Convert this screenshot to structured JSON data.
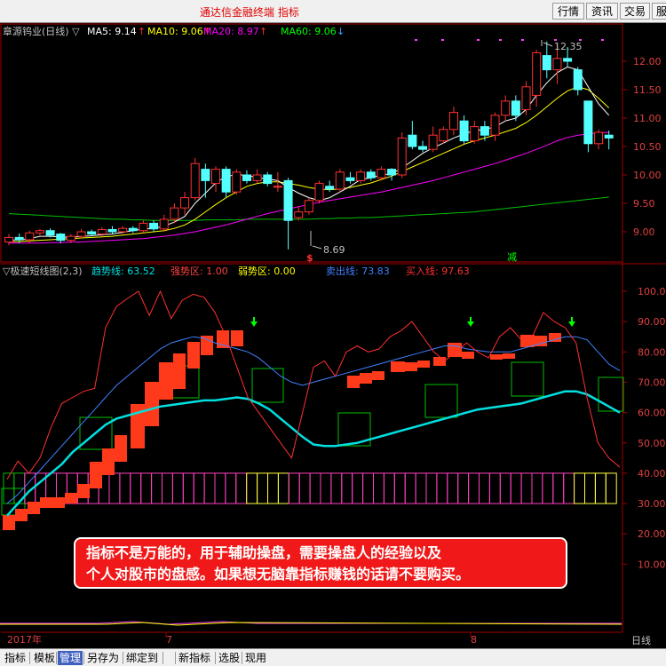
{
  "app": {
    "title": "通达信金融终端  指标",
    "buttons": [
      "行情",
      "资讯",
      "交易",
      "服"
    ]
  },
  "main_panel": {
    "stock_title": "章源钨业(日线) ▽",
    "ma_labels": [
      {
        "text": "MA5: 9.14",
        "arrow": "↑",
        "color": "#ffffff"
      },
      {
        "text": "MA10: 9.06",
        "arrow": "↑",
        "color": "#ffff00"
      },
      {
        "text": "MA20: 8.97",
        "arrow": "↑",
        "color": "#ff00ff"
      },
      {
        "text": "MA60: 9.06",
        "arrow": "↓",
        "color": "#00ff00"
      }
    ],
    "high_label": "12.35",
    "low_label": "8.69",
    "buy_sign": "$",
    "sell_sign": "减"
  },
  "indicator_panel": {
    "title": "▽极速短线图(2,3)",
    "labels": [
      {
        "text": "趋势线: 63.52",
        "color": "#00e0e0"
      },
      {
        "text": "强势区: 1.00",
        "color": "#ff4040"
      },
      {
        "text": "弱势区: 0.00",
        "color": "#ffff00"
      },
      {
        "text": "卖出线: 73.83",
        "color": "#4080ff"
      },
      {
        "text": "买入线: 97.63",
        "color": "#ff3030"
      }
    ]
  },
  "disclaimer": {
    "line1": "指标不是万能的，用于辅助操盘，需要操盘人的经验以及",
    "line2": "个人对股市的盘感。如果想无脑靠指标赚钱的话请不要购买。"
  },
  "date_axis": {
    "labels": [
      "2017年",
      "7",
      "8"
    ],
    "period": "日线"
  },
  "bottom_tabs": [
    "指标",
    "模板",
    "管理",
    "另存为",
    "绑定到",
    "新指标",
    "选股",
    "现用"
  ],
  "bottom_tab_active": "管理",
  "chart_data": [
    {
      "type": "candlestick",
      "title": "章源钨业(日线)",
      "y_ticks": [
        "12.00",
        "11.50",
        "11.00",
        "10.50",
        "10.00",
        "9.50",
        "9.00"
      ],
      "ylim": [
        8.6,
        12.6
      ],
      "candles": [
        {
          "o": 8.82,
          "c": 8.9,
          "h": 8.96,
          "l": 8.76
        },
        {
          "o": 8.9,
          "c": 8.86,
          "h": 8.97,
          "l": 8.8
        },
        {
          "o": 8.86,
          "c": 8.98,
          "h": 9.02,
          "l": 8.8
        },
        {
          "o": 8.98,
          "c": 9.02,
          "h": 9.05,
          "l": 8.92
        },
        {
          "o": 9.02,
          "c": 8.94,
          "h": 9.06,
          "l": 8.9
        },
        {
          "o": 8.96,
          "c": 8.85,
          "h": 8.98,
          "l": 8.8
        },
        {
          "o": 8.85,
          "c": 8.92,
          "h": 8.96,
          "l": 8.8
        },
        {
          "o": 8.92,
          "c": 9.0,
          "h": 9.05,
          "l": 8.88
        },
        {
          "o": 9.0,
          "c": 8.96,
          "h": 9.04,
          "l": 8.92
        },
        {
          "o": 8.96,
          "c": 9.04,
          "h": 9.08,
          "l": 8.92
        },
        {
          "o": 9.04,
          "c": 9.0,
          "h": 9.1,
          "l": 8.96
        },
        {
          "o": 9.0,
          "c": 9.06,
          "h": 9.1,
          "l": 8.96
        },
        {
          "o": 9.06,
          "c": 9.02,
          "h": 9.1,
          "l": 8.98
        },
        {
          "o": 9.02,
          "c": 9.15,
          "h": 9.2,
          "l": 8.98
        },
        {
          "o": 9.15,
          "c": 9.05,
          "h": 9.2,
          "l": 9.0
        },
        {
          "o": 9.05,
          "c": 9.22,
          "h": 9.3,
          "l": 9.0
        },
        {
          "o": 9.22,
          "c": 9.42,
          "h": 9.5,
          "l": 9.15
        },
        {
          "o": 9.42,
          "c": 9.6,
          "h": 9.7,
          "l": 9.3
        },
        {
          "o": 9.6,
          "c": 10.2,
          "h": 10.3,
          "l": 9.55
        },
        {
          "o": 10.1,
          "c": 9.9,
          "h": 10.2,
          "l": 9.6
        },
        {
          "o": 9.85,
          "c": 10.1,
          "h": 10.15,
          "l": 9.7
        },
        {
          "o": 10.1,
          "c": 9.7,
          "h": 10.15,
          "l": 9.6
        },
        {
          "o": 9.7,
          "c": 10.05,
          "h": 10.1,
          "l": 9.65
        },
        {
          "o": 10.0,
          "c": 9.9,
          "h": 10.08,
          "l": 9.85
        },
        {
          "o": 9.9,
          "c": 10.0,
          "h": 10.1,
          "l": 9.85
        },
        {
          "o": 10.0,
          "c": 9.85,
          "h": 10.05,
          "l": 9.8
        },
        {
          "o": 9.8,
          "c": 9.8,
          "h": 10.05,
          "l": 9.7
        },
        {
          "o": 9.9,
          "c": 9.2,
          "h": 9.95,
          "l": 8.69
        },
        {
          "o": 9.25,
          "c": 9.35,
          "h": 9.45,
          "l": 9.2
        },
        {
          "o": 9.35,
          "c": 9.55,
          "h": 9.6,
          "l": 9.3
        },
        {
          "o": 9.55,
          "c": 9.85,
          "h": 9.9,
          "l": 9.5
        },
        {
          "o": 9.8,
          "c": 9.75,
          "h": 9.9,
          "l": 9.7
        },
        {
          "o": 9.75,
          "c": 10.05,
          "h": 10.1,
          "l": 9.7
        },
        {
          "o": 9.95,
          "c": 9.9,
          "h": 10.05,
          "l": 9.85
        },
        {
          "o": 9.9,
          "c": 10.05,
          "h": 10.1,
          "l": 9.85
        },
        {
          "o": 10.05,
          "c": 9.95,
          "h": 10.1,
          "l": 9.9
        },
        {
          "o": 9.95,
          "c": 10.1,
          "h": 10.15,
          "l": 9.9
        },
        {
          "o": 10.1,
          "c": 10.0,
          "h": 10.12,
          "l": 9.9
        },
        {
          "o": 10.0,
          "c": 10.65,
          "h": 10.75,
          "l": 9.95
        },
        {
          "o": 10.7,
          "c": 10.5,
          "h": 10.95,
          "l": 10.45
        },
        {
          "o": 10.5,
          "c": 10.45,
          "h": 10.6,
          "l": 10.4
        },
        {
          "o": 10.45,
          "c": 10.7,
          "h": 10.85,
          "l": 10.4
        },
        {
          "o": 10.6,
          "c": 10.8,
          "h": 10.85,
          "l": 10.55
        },
        {
          "o": 10.8,
          "c": 11.1,
          "h": 11.2,
          "l": 10.7
        },
        {
          "o": 10.95,
          "c": 10.6,
          "h": 11.05,
          "l": 10.55
        },
        {
          "o": 10.6,
          "c": 10.85,
          "h": 10.95,
          "l": 10.55
        },
        {
          "o": 10.85,
          "c": 10.7,
          "h": 10.95,
          "l": 10.6
        },
        {
          "o": 10.7,
          "c": 11.05,
          "h": 11.1,
          "l": 10.6
        },
        {
          "o": 11.05,
          "c": 11.3,
          "h": 11.4,
          "l": 10.95
        },
        {
          "o": 11.3,
          "c": 11.05,
          "h": 11.4,
          "l": 10.95
        },
        {
          "o": 11.15,
          "c": 11.55,
          "h": 11.65,
          "l": 11.05
        },
        {
          "o": 11.4,
          "c": 12.15,
          "h": 12.2,
          "l": 11.2
        },
        {
          "o": 12.1,
          "c": 11.85,
          "h": 12.35,
          "l": 11.7
        },
        {
          "o": 11.85,
          "c": 12.05,
          "h": 12.3,
          "l": 11.6
        },
        {
          "o": 12.05,
          "c": 12.0,
          "h": 12.25,
          "l": 11.9
        },
        {
          "o": 11.85,
          "c": 11.5,
          "h": 11.9,
          "l": 11.4
        },
        {
          "o": 11.3,
          "c": 10.55,
          "h": 11.3,
          "l": 10.4
        },
        {
          "o": 10.55,
          "c": 10.75,
          "h": 10.8,
          "l": 10.45
        },
        {
          "o": 10.7,
          "c": 10.65,
          "h": 10.78,
          "l": 10.45
        }
      ],
      "ma5": [
        8.85,
        8.86,
        8.88,
        8.92,
        8.92,
        8.91,
        8.9,
        8.92,
        8.93,
        8.95,
        8.96,
        8.99,
        9.02,
        9.05,
        9.06,
        9.1,
        9.17,
        9.27,
        9.5,
        9.68,
        9.86,
        9.98,
        10.0,
        10.0,
        9.95,
        9.93,
        9.9,
        9.78,
        9.68,
        9.6,
        9.55,
        9.6,
        9.7,
        9.8,
        9.92,
        9.95,
        10.0,
        10.02,
        10.12,
        10.25,
        10.38,
        10.48,
        10.56,
        10.65,
        10.72,
        10.78,
        10.8,
        10.85,
        10.95,
        11.0,
        11.15,
        11.4,
        11.62,
        11.8,
        11.9,
        11.85,
        11.55,
        11.25,
        11.05
      ],
      "ma10": [
        8.82,
        8.83,
        8.84,
        8.85,
        8.86,
        8.87,
        8.88,
        8.89,
        8.9,
        8.91,
        8.92,
        8.94,
        8.96,
        8.98,
        9.0,
        9.02,
        9.06,
        9.12,
        9.22,
        9.35,
        9.48,
        9.6,
        9.7,
        9.8,
        9.85,
        9.88,
        9.88,
        9.85,
        9.82,
        9.78,
        9.75,
        9.74,
        9.75,
        9.78,
        9.82,
        9.86,
        9.92,
        9.98,
        10.06,
        10.14,
        10.22,
        10.3,
        10.38,
        10.46,
        10.54,
        10.6,
        10.65,
        10.7,
        10.76,
        10.82,
        10.92,
        11.05,
        11.2,
        11.35,
        11.48,
        11.55,
        11.5,
        11.35,
        11.18
      ],
      "ma20": [
        8.8,
        8.8,
        8.8,
        8.8,
        8.81,
        8.81,
        8.82,
        8.82,
        8.83,
        8.84,
        8.85,
        8.86,
        8.87,
        8.88,
        8.9,
        8.92,
        8.94,
        8.97,
        9.0,
        9.04,
        9.08,
        9.12,
        9.17,
        9.22,
        9.27,
        9.32,
        9.36,
        9.4,
        9.44,
        9.48,
        9.52,
        9.55,
        9.58,
        9.61,
        9.64,
        9.67,
        9.7,
        9.74,
        9.78,
        9.82,
        9.86,
        9.9,
        9.95,
        10.0,
        10.05,
        10.1,
        10.15,
        10.2,
        10.26,
        10.32,
        10.38,
        10.45,
        10.52,
        10.6,
        10.66,
        10.7,
        10.72,
        10.74,
        10.75
      ],
      "ma60": [
        9.32,
        9.31,
        9.3,
        9.29,
        9.28,
        9.27,
        9.26,
        9.25,
        9.24,
        9.23,
        9.22,
        9.22,
        9.21,
        9.21,
        9.2,
        9.2,
        9.2,
        9.2,
        9.2,
        9.21,
        9.21,
        9.21,
        9.21,
        9.22,
        9.22,
        9.22,
        9.22,
        9.22,
        9.22,
        9.22,
        9.23,
        9.23,
        9.24,
        9.24,
        9.25,
        9.25,
        9.26,
        9.27,
        9.28,
        9.29,
        9.3,
        9.31,
        9.32,
        9.33,
        9.34,
        9.35,
        9.37,
        9.39,
        9.41,
        9.43,
        9.45,
        9.47,
        9.49,
        9.51,
        9.53,
        9.55,
        9.57,
        9.59,
        9.61
      ]
    },
    {
      "type": "line",
      "title": "极速短线图(2,3)",
      "y_ticks": [
        "100.0",
        "90.00",
        "80.00",
        "70.00",
        "60.00",
        "50.00",
        "40.00",
        "30.00",
        "20.00",
        "10.00"
      ],
      "ylim": [
        0,
        105
      ],
      "series": [
        {
          "name": "趋势线",
          "color": "#00e0e0",
          "values": [
            26,
            30,
            34,
            37,
            40,
            43,
            47,
            50,
            53,
            56,
            58,
            59,
            60,
            61,
            62,
            62.5,
            63,
            63.5,
            64,
            64,
            64.5,
            65,
            64.5,
            63,
            61,
            58,
            55,
            52,
            49.5,
            49,
            49,
            49.5,
            50,
            51,
            52,
            53,
            54,
            55,
            56,
            57,
            58,
            59,
            60,
            61,
            61.5,
            62,
            62.5,
            63,
            64,
            65,
            66,
            67,
            67,
            66,
            64,
            62,
            60
          ]
        },
        {
          "name": "卖出线",
          "color": "#4080ff",
          "values": [
            30,
            33,
            37,
            41,
            45,
            49,
            53,
            57,
            61,
            65,
            69,
            72,
            75,
            78,
            81,
            83,
            84,
            85,
            84.5,
            83,
            82,
            81,
            80,
            78,
            75,
            72,
            70,
            69,
            70,
            71,
            72,
            73,
            74,
            75,
            76,
            77,
            78,
            79,
            80,
            81,
            82,
            82,
            81,
            80.5,
            80,
            80,
            80,
            81,
            82,
            83,
            84,
            85,
            85,
            84,
            80,
            76,
            73.83
          ]
        },
        {
          "name": "买入线",
          "color": "#ff3030",
          "values": [
            38,
            44,
            40,
            45,
            55,
            63,
            65,
            67,
            68,
            88,
            95,
            97.63,
            100,
            92,
            100,
            91,
            97,
            99,
            98,
            93,
            85,
            75,
            65,
            60,
            55,
            50,
            45,
            60,
            75,
            77,
            72,
            80,
            82,
            80,
            81,
            85,
            87,
            90,
            85,
            80,
            77,
            80,
            83,
            80,
            78,
            85,
            88,
            84,
            85,
            93,
            90,
            88,
            83,
            65,
            50,
            45,
            42
          ]
        }
      ]
    }
  ]
}
